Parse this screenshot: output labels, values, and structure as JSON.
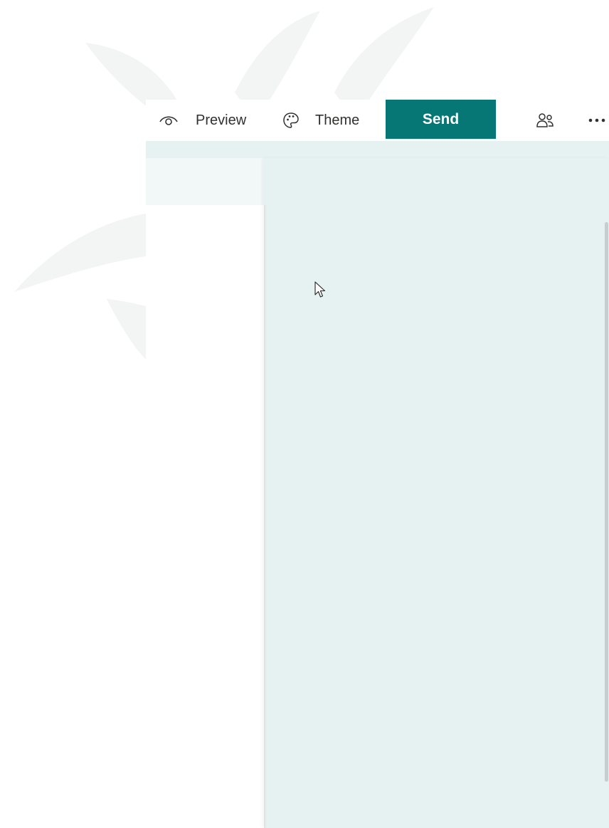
{
  "toolbar": {
    "preview_label": "Preview",
    "theme_label": "Theme",
    "send_label": "Send",
    "icons": {
      "preview": "eye-icon",
      "theme": "palette-icon",
      "collaborate": "people-icon",
      "more": "more-options-icon"
    }
  },
  "colors": {
    "accent": "#077775",
    "panel_background": "#e6f1f1",
    "tab_background": "#f2f8f8",
    "text": "#323130"
  }
}
